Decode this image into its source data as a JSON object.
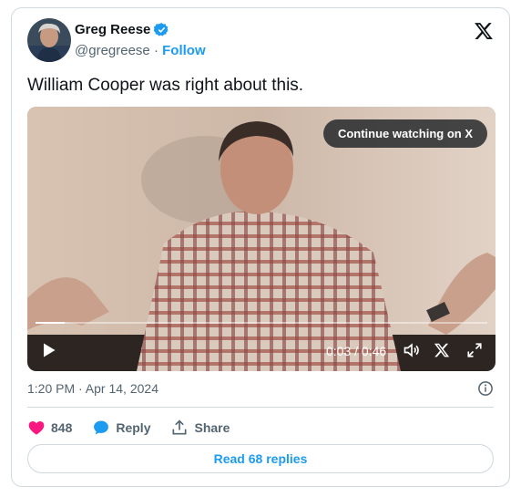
{
  "author": {
    "name": "Greg Reese",
    "handle": "@gregreese",
    "separator": "·",
    "follow_label": "Follow"
  },
  "tweet": {
    "text": "William Cooper was right about this."
  },
  "video": {
    "continue_label": "Continue watching on X",
    "time": "0:03 / 0:46",
    "progress": 0.065
  },
  "meta": {
    "timestamp": "1:20 PM · Apr 14, 2024"
  },
  "actions": {
    "likes": "848",
    "reply_label": "Reply",
    "share_label": "Share"
  },
  "read_replies_label": "Read 68 replies",
  "colors": {
    "accent": "#1d9bf0",
    "like": "#f91880",
    "text_secondary": "#536471",
    "border": "#cfd9de"
  },
  "icons": [
    "verified-icon",
    "x-logo-icon",
    "play-icon",
    "volume-icon",
    "x-watermark-icon",
    "fullscreen-icon",
    "info-icon",
    "heart-icon",
    "reply-icon",
    "share-icon"
  ]
}
